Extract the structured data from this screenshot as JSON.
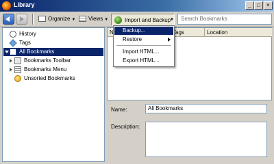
{
  "window": {
    "title": "Library",
    "min": "_",
    "max": "□",
    "close": "×"
  },
  "toolbar": {
    "organize": "Organize",
    "views": "Views",
    "import_backup": "Import and Backup",
    "search_placeholder": "Search Bookmarks"
  },
  "tree": {
    "items": [
      {
        "label": "History",
        "icon": "history-icon"
      },
      {
        "label": "Tags",
        "icon": "tag-icon"
      },
      {
        "label": "All Bookmarks",
        "icon": "star-icon",
        "selected": true
      },
      {
        "label": "Bookmarks Toolbar",
        "icon": "toolbar-folder-icon"
      },
      {
        "label": "Bookmarks Menu",
        "icon": "menu-folder-icon"
      },
      {
        "label": "Unsorted Bookmarks",
        "icon": "unsorted-folder-icon"
      }
    ]
  },
  "list": {
    "columns": [
      "N",
      "Tags",
      "Location"
    ]
  },
  "menu": {
    "items": [
      {
        "label": "Backup..."
      },
      {
        "label": "Restore"
      },
      {
        "label": "Import HTML..."
      },
      {
        "label": "Export HTML..."
      }
    ]
  },
  "details": {
    "name_label": "Name:",
    "name_value": "All Bookmarks",
    "description_label": "Description:",
    "description_value": ""
  }
}
